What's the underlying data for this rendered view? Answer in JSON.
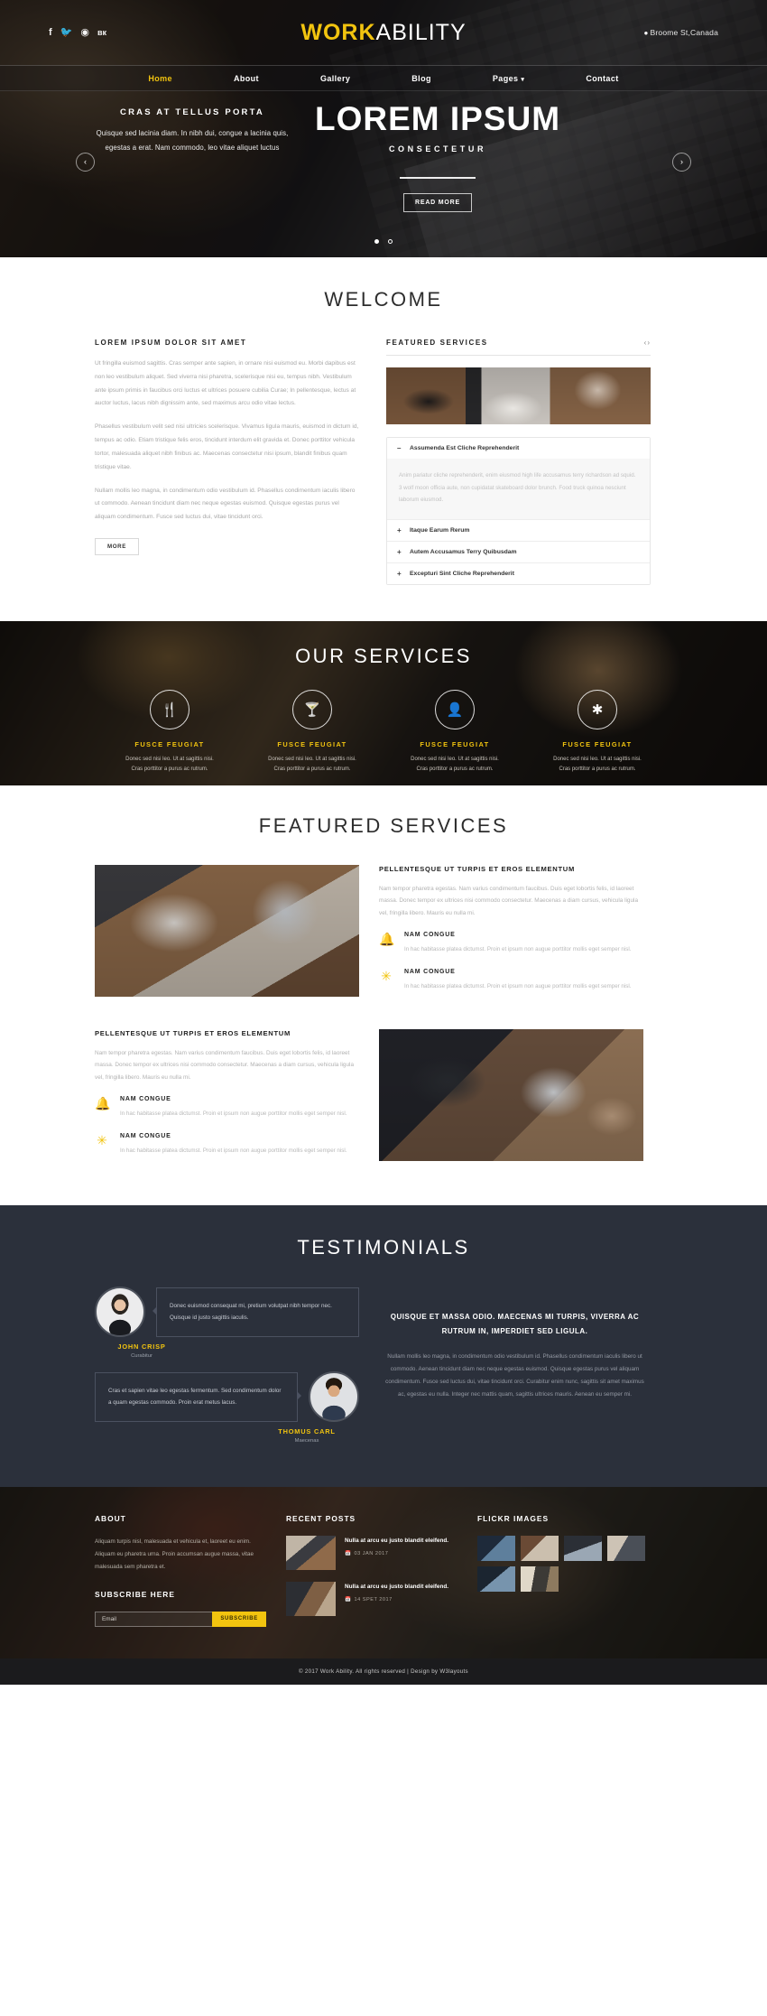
{
  "header": {
    "brand_bold": "WORK",
    "brand_light": "ABILITY",
    "address": "Broome St,Canada",
    "pin_icon": "location-pin-icon",
    "socials": [
      {
        "name": "facebook-icon",
        "glyph": "f"
      },
      {
        "name": "twitter-icon",
        "glyph": "🐦"
      },
      {
        "name": "rss-icon",
        "glyph": "◔"
      },
      {
        "name": "vk-icon",
        "glyph": "вк"
      }
    ],
    "nav": [
      {
        "label": "Home",
        "active": true
      },
      {
        "label": "About",
        "active": false
      },
      {
        "label": "Gallery",
        "active": false
      },
      {
        "label": "Blog",
        "active": false
      },
      {
        "label": "Pages",
        "active": false,
        "caret": "▾"
      },
      {
        "label": "Contact",
        "active": false
      }
    ]
  },
  "slider": {
    "left_heading": "CRAS AT TELLUS PORTA",
    "left_text": "Quisque sed lacinia diam. In nibh dui, congue a lacinia quis, egestas a erat. Nam commodo, leo vitae aliquet luctus",
    "title": "LOREM IPSUM",
    "subtitle": "CONSECTETUR",
    "button": "READ MORE",
    "prev_icon": "chevron-left-icon",
    "next_icon": "chevron-right-icon",
    "prev_glyph": "‹",
    "next_glyph": "›"
  },
  "welcome": {
    "title": "WELCOME",
    "left_heading": "LOREM IPSUM DOLOR SIT AMET",
    "p1": "Ut fringilla euismod sagittis. Cras semper ante sapien, in ornare nisi euismod eu. Morbi dapibus est non leo vestibulum aliquet. Sed viverra nisi pharetra, scelerisque nisi eu, tempus nibh. Vestibulum ante ipsum primis in faucibus orci luctus et ultrices posuere cubilia Curae; In pellentesque, lectus at auctor luctus, lacus nibh dignissim ante, sed maximus arcu odio vitae lectus.",
    "p2": "Phasellus vestibulum velit sed nisi ultricies scelerisque. Vivamus ligula mauris, euismod in dictum id, tempus ac odio. Etiam tristique felis eros, tincidunt interdum elit gravida et. Donec porttitor vehicula tortor, malesuada aliquet nibh finibus ac. Maecenas consectetur nisi ipsum, blandit finibus quam tristique vitae.",
    "p3": "Nullam mollis leo magna, in condimentum odio vestibulum id. Phasellus condimentum iaculis libero ut commodo. Aenean tincidunt diam nec neque egestas euismod. Quisque egestas purus vel aliquam condimentum. Fusce sed luctus dui, vitae tincidunt orci.",
    "more_button": "MORE",
    "featured_heading": "FEATURED SERVICES",
    "featured_nav_prev": "‹",
    "featured_nav_next": "›",
    "accordion": [
      {
        "sign": "–",
        "title": "Assumenda Est Cliche Reprehenderit",
        "body": "Anim pariatur cliche reprehenderit, enim eiusmod high life accusamus terry richardson ad squid. 3 wolf moon officia aute, non cupidatat skateboard dolor brunch. Food truck quinoa nesciunt laborum eiusmod.",
        "open": true
      },
      {
        "sign": "+",
        "title": "Itaque Earum Rerum",
        "open": false
      },
      {
        "sign": "+",
        "title": "Autem Accusamus Terry Quibusdam",
        "open": false
      },
      {
        "sign": "+",
        "title": "Excepturi Sint Cliche Reprehenderit",
        "open": false
      }
    ]
  },
  "our_services": {
    "title": "OUR SERVICES",
    "items": [
      {
        "icon": "cutlery-icon",
        "glyph": "🍴",
        "title": "FUSCE FEUGIAT",
        "text": "Donec sed nisi leo. Ut at sagittis nisi. Cras porttitor a purus ac rutrum."
      },
      {
        "icon": "cocktail-glass-icon",
        "glyph": "🍸",
        "title": "FUSCE FEUGIAT",
        "text": "Donec sed nisi leo. Ut at sagittis nisi. Cras porttitor a purus ac rutrum."
      },
      {
        "icon": "user-icon",
        "glyph": "👤",
        "title": "FUSCE FEUGIAT",
        "text": "Donec sed nisi leo. Ut at sagittis nisi. Cras porttitor a purus ac rutrum."
      },
      {
        "icon": "asterisk-icon",
        "glyph": "✱",
        "title": "FUSCE FEUGIAT",
        "text": "Donec sed nisi leo. Ut at sagittis nisi. Cras porttitor a purus ac rutrum."
      }
    ]
  },
  "featured_services": {
    "title": "FEATURED SERVICES",
    "block1": {
      "heading": "PELLENTESQUE UT TURPIS ET EROS ELEMENTUM",
      "intro": "Nam tempor pharetra egestas. Nam varius condimentum faucibus. Duis eget lobortis felis, id laoreet massa. Donec tempor ex ultrices nisi commodo consectetur. Maecenas a diam cursus, vehicula ligula vel, fringilla libero. Mauris eu nulla mi.",
      "bullets": [
        {
          "icon": "bell-icon",
          "glyph": "🔔",
          "title": "NAM CONGUE",
          "text": "In hac habitasse platea dictumst. Proin et ipsum non augue porttitor mollis eget semper nisl."
        },
        {
          "icon": "asterisk-icon",
          "glyph": "✳",
          "title": "NAM CONGUE",
          "text": "In hac habitasse platea dictumst. Proin et ipsum non augue porttitor mollis eget semper nisl."
        }
      ]
    },
    "block2": {
      "heading": "PELLENTESQUE UT TURPIS ET EROS ELEMENTUM",
      "intro": "Nam tempor pharetra egestas. Nam varius condimentum faucibus. Duis eget lobortis felis, id laoreet massa. Donec tempor ex ultrices nisi commodo consectetur. Maecenas a diam cursus, vehicula ligula vel, fringilla libero. Mauris eu nulla mi.",
      "bullets": [
        {
          "icon": "bell-icon",
          "glyph": "🔔",
          "title": "NAM CONGUE",
          "text": "In hac habitasse platea dictumst. Proin et ipsum non augue porttitor mollis eget semper nisl."
        },
        {
          "icon": "asterisk-icon",
          "glyph": "✳",
          "title": "NAM CONGUE",
          "text": "In hac habitasse platea dictumst. Proin et ipsum non augue porttitor mollis eget semper nisl."
        }
      ]
    }
  },
  "testimonials": {
    "title": "TESTIMONIALS",
    "items": [
      {
        "quote": "Donec euismod consequat mi, pretium volutpat nibh tempor nec. Quisque id justo sagittis iaculis.",
        "name": "JOHN CRISP",
        "role": "Curabitur",
        "avatar": "avatar-female"
      },
      {
        "quote": "Cras et sapien vitae leo egestas fermentum. Sed condimentum dolor a quam egestas commodo. Proin erat metus lacus.",
        "name": "THOMUS CARL",
        "role": "Maecenas",
        "avatar": "avatar-male"
      }
    ],
    "right_heading": "QUISQUE ET MASSA ODIO. MAECENAS MI TURPIS, VIVERRA AC RUTRUM IN, IMPERDIET SED LIGULA.",
    "right_text": "Nullam mollis leo magna, in condimentum odio vestibulum id. Phasellus condimentum iaculis libero ut commodo. Aenean tincidunt diam nec neque egestas euismod. Quisque egestas purus vel aliquam condimentum. Fusce sed luctus dui, vitae tincidunt orci. Curabitur enim nunc, sagittis sit amet maximus ac, egestas eu nulla. Integer nec mattis quam, sagittis ultrices mauris. Aenean eu semper mi."
  },
  "footer": {
    "about_title": "ABOUT",
    "about_text": "Aliquam turpis nisl, malesuada et vehicula et, laoreet eu enim. Aliquam eu pharetra urna. Proin accumsan augue massa, vitae malesuada sem pharetra et.",
    "subscribe_title": "SUBSCRIBE HERE",
    "subscribe_placeholder": "Email",
    "subscribe_value": "",
    "subscribe_button": "SUBSCRIBE",
    "recent_title": "RECENT POSTS",
    "posts": [
      {
        "title": "Nulla at arcu eu justo blandit eleifend.",
        "date": "03 JAN 2017",
        "cal_icon": "calendar-icon",
        "cal_glyph": "🗓"
      },
      {
        "title": "Nulla at arcu eu justo blandit eleifend.",
        "date": "14 SPET 2017",
        "cal_icon": "calendar-icon",
        "cal_glyph": "🗓"
      }
    ],
    "flickr_title": "FLICKR IMAGES",
    "copyright": "© 2017 Work Ability. All rights reserved | Design by W3layouts",
    "accent": "#f2c40f"
  }
}
